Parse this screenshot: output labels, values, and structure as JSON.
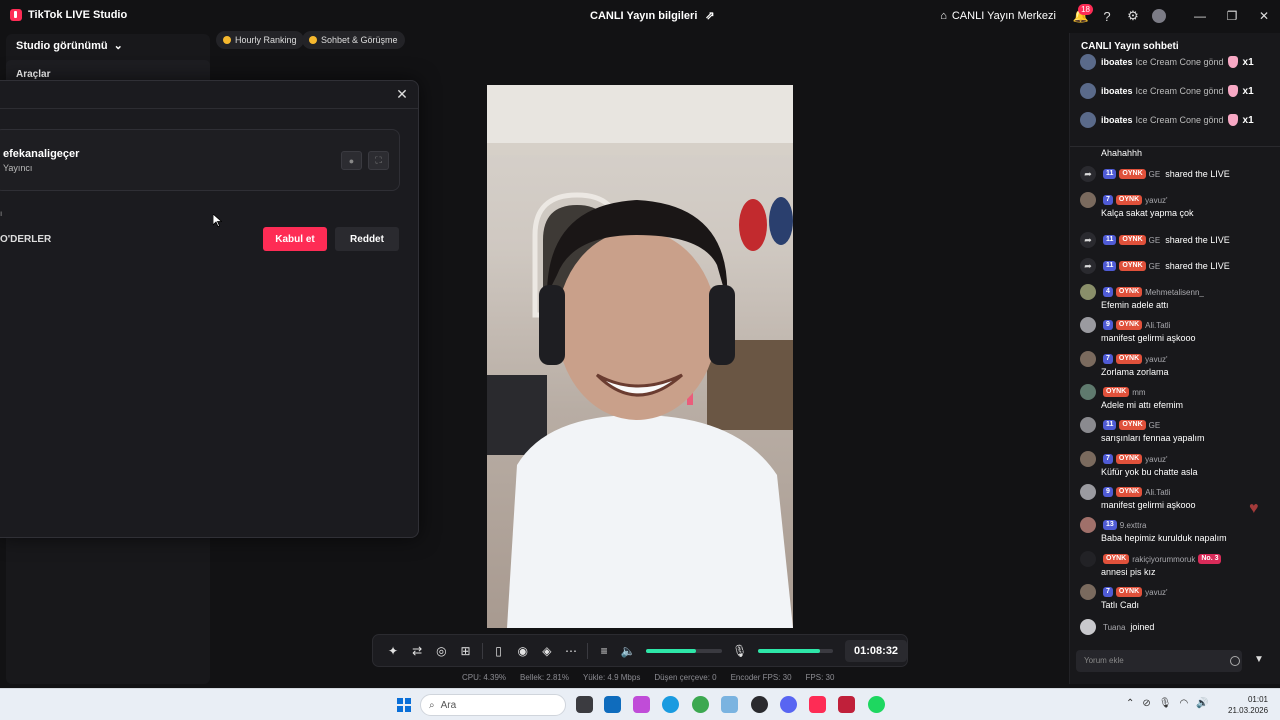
{
  "app": {
    "title": "TikTok LIVE Studio",
    "center_title": "CANLI Yayın bilgileri"
  },
  "header": {
    "live_center": "CANLI Yayın Merkezi",
    "notification_count": "18"
  },
  "left": {
    "studio_view": "Studio görünümü",
    "tools": "Araçlar"
  },
  "chips": {
    "ranking": "Hourly Ranking",
    "chat": "Sohbet & Görüşme"
  },
  "dialog": {
    "user_name": "efekanaligeçer",
    "user_role": "Yayıncı",
    "small_label": "ı",
    "section_label": "O'DERLER",
    "accept": "Kabul et",
    "reject": "Reddet"
  },
  "toolbar": {
    "timer": "01:08:32",
    "volume_level": 0.66,
    "mic_level": 0.82
  },
  "stats": {
    "cpu": "CPU:  4.39%",
    "memory": "Bellek:  2.81%",
    "upload": "Yükle:  4.9 Mbps",
    "dropped": "Düşen çerçeve:  0",
    "encoder_fps": "Encoder FPS:  30",
    "fps": "FPS:  30"
  },
  "chat": {
    "title": "CANLI Yayın sohbeti",
    "gifts": [
      {
        "user": "iboates",
        "text": "Ice Cream Cone gönd",
        "count": "x1"
      },
      {
        "user": "iboates",
        "text": "Ice Cream Cone gönd",
        "count": "x1"
      },
      {
        "user": "iboates",
        "text": "Ice Cream Cone gönd",
        "count": "x1"
      }
    ],
    "top_text": "Ahahahhh",
    "messages": [
      {
        "kind": "share",
        "user": "GE",
        "level": "11",
        "fan": "OYNK",
        "text": "shared the LIVE"
      },
      {
        "kind": "msg",
        "user": "yavuz'",
        "level": "7",
        "fan": "OYNK",
        "text": "Kalça sakat yapma çok",
        "color": "#7a6a5e"
      },
      {
        "kind": "share",
        "user": "GE",
        "level": "11",
        "fan": "OYNK",
        "text": "shared the LIVE"
      },
      {
        "kind": "share",
        "user": "GE",
        "level": "11",
        "fan": "OYNK",
        "text": "shared the LIVE"
      },
      {
        "kind": "msg",
        "user": "Mehmetalisenn_",
        "level": "4",
        "fan": "OYNK",
        "text": "Efemin adele attı",
        "color": "#8a8f6a"
      },
      {
        "kind": "msg",
        "user": "Ali.Tatli",
        "level": "9",
        "fan": "OYNK",
        "text": "manifest gelirmi aşkooo",
        "color": "#9a9aa0"
      },
      {
        "kind": "msg",
        "user": "yavuz'",
        "level": "7",
        "fan": "OYNK",
        "text": "Zorlama zorlama",
        "color": "#7a6a5e"
      },
      {
        "kind": "msg",
        "user": "mm",
        "level": "",
        "fan": "OYNK",
        "text": "Adele mi attı efemim",
        "color": "#5f7a6e"
      },
      {
        "kind": "msg",
        "user": "GE",
        "level": "11",
        "fan": "OYNK",
        "text": "sarışınları fennaa yapalım",
        "color": "#8a8a8f"
      },
      {
        "kind": "msg",
        "user": "yavuz'",
        "level": "7",
        "fan": "OYNK",
        "text": "Küfür yok bu chatte asla",
        "color": "#7a6a5e"
      },
      {
        "kind": "msg",
        "user": "Ali.Tatli",
        "level": "9",
        "fan": "OYNK",
        "text": "manifest gelirmi aşkooo",
        "color": "#9a9aa0"
      },
      {
        "kind": "msg",
        "user": "9.exttra",
        "level": "13",
        "fan": "",
        "text": "Baba hepimiz kurulduk napalım",
        "color": "#a0706a"
      },
      {
        "kind": "msg",
        "user": "rakiçiyorummoruk",
        "level": "",
        "fan": "OYNK",
        "text": "annesi pis kız",
        "color": "#222226",
        "extra": "No. 3"
      },
      {
        "kind": "msg",
        "user": "yavuz'",
        "level": "7",
        "fan": "OYNK",
        "text": "Tatlı Cadı",
        "color": "#7a6a5e"
      },
      {
        "kind": "join",
        "user": "Tuana",
        "text": "joined"
      }
    ],
    "input_placeholder": "Yorum ekle"
  },
  "taskbar": {
    "search": "Ara",
    "time": "01:01",
    "date": "21.03.2026"
  },
  "colors": {
    "accent": "#fe2c55",
    "audio": "#2ee6a8",
    "level_badge": "#4f5bd5"
  }
}
